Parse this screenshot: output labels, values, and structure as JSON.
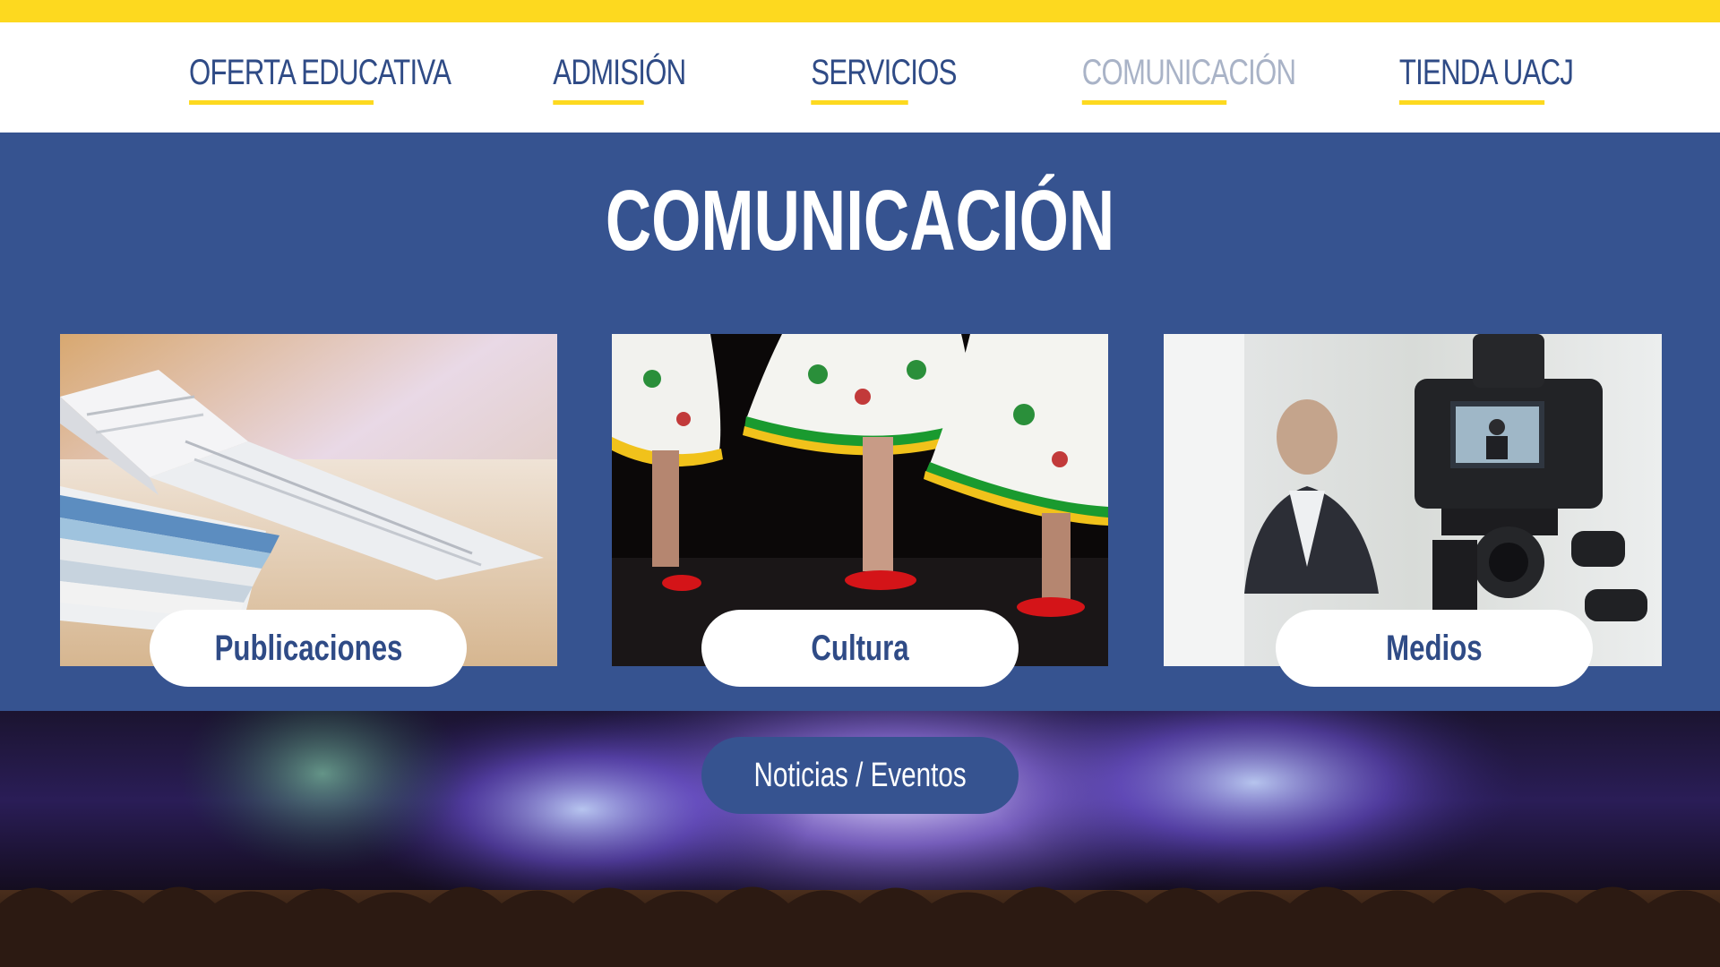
{
  "nav": {
    "items": [
      {
        "label": "OFERTA EDUCATIVA"
      },
      {
        "label": "ADMISIÓN"
      },
      {
        "label": "SERVICIOS"
      },
      {
        "label": "COMUNICACIÓN"
      },
      {
        "label": "TIENDA UACJ"
      }
    ],
    "active_index": 3
  },
  "main": {
    "title": "COMUNICACIÓN",
    "cards": [
      {
        "label": "Publicaciones",
        "image": "magazines-photo"
      },
      {
        "label": "Cultura",
        "image": "folk-dancers-photo"
      },
      {
        "label": "Medios",
        "image": "camera-interview-photo"
      }
    ]
  },
  "footer": {
    "button_label": "Noticias / Eventos",
    "image": "concert-crowd-photo"
  },
  "colors": {
    "accent_yellow": "#fdd91f",
    "brand_blue": "#365390",
    "nav_text": "#2f4b86",
    "nav_active_text": "#a9b3c7"
  }
}
